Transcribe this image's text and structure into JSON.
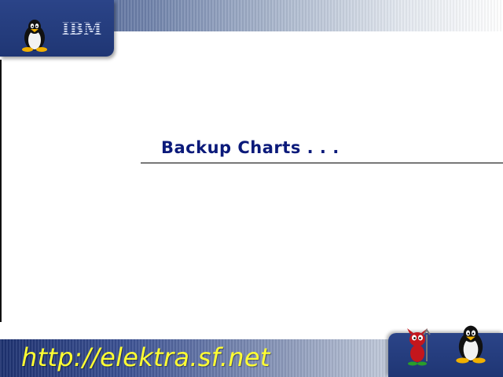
{
  "header": {
    "brand": "IBM"
  },
  "slide": {
    "title": "Backup Charts . . ."
  },
  "footer": {
    "url": "http://elektra.sf.net"
  },
  "icons": {
    "top_left": "tux-penguin-icon",
    "top_brand": "ibm-logo",
    "bottom_left": "bsd-daemon-icon",
    "bottom_right": "tux-penguin-icon"
  },
  "colors": {
    "banner_blue": "#1f3674",
    "title_navy": "#0b1a7a",
    "url_yellow": "#ffff33"
  }
}
